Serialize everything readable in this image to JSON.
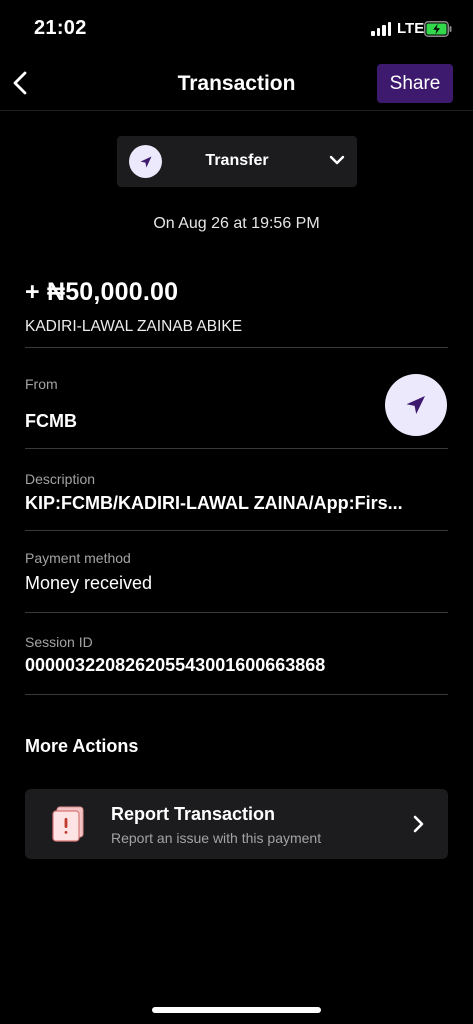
{
  "status_bar": {
    "time": "21:02",
    "network": "LTE",
    "icons": [
      "signal-icon",
      "battery-charging-icon"
    ]
  },
  "nav": {
    "title": "Transaction",
    "share_label": "Share",
    "back_icon": "chevron-left-icon"
  },
  "colors": {
    "background": "#000000",
    "card": "#1c1c1e",
    "accent": "#3d1a6e",
    "icon_bg": "#ebe9fb",
    "icon_fg": "#3d1a6e",
    "muted_text": "#a3a3a3",
    "divider": "#3a3a3a"
  },
  "type_select": {
    "label": "Transfer",
    "icon": "send-arrow-icon",
    "chevron_icon": "chevron-down-icon"
  },
  "transaction": {
    "date": "On Aug 26 at 19:56 PM",
    "amount": "+ ₦50,000.00",
    "payer": "KADIRI-LAWAL ZAINAB ABIKE"
  },
  "details": {
    "from": {
      "label": "From",
      "value": "FCMB",
      "icon": "send-arrow-icon"
    },
    "description": {
      "label": "Description",
      "value": "KIP:FCMB/KADIRI-LAWAL ZAINA/App:Firs..."
    },
    "payment_method": {
      "label": "Payment method",
      "value": "Money received"
    },
    "session_id": {
      "label": "Session ID",
      "value": "000003220826205543001600663868"
    }
  },
  "more_actions": {
    "title": "More Actions",
    "report": {
      "title": "Report Transaction",
      "subtitle": "Report an issue with this payment",
      "icon": "report-document-icon",
      "chevron_icon": "chevron-right-icon"
    }
  }
}
